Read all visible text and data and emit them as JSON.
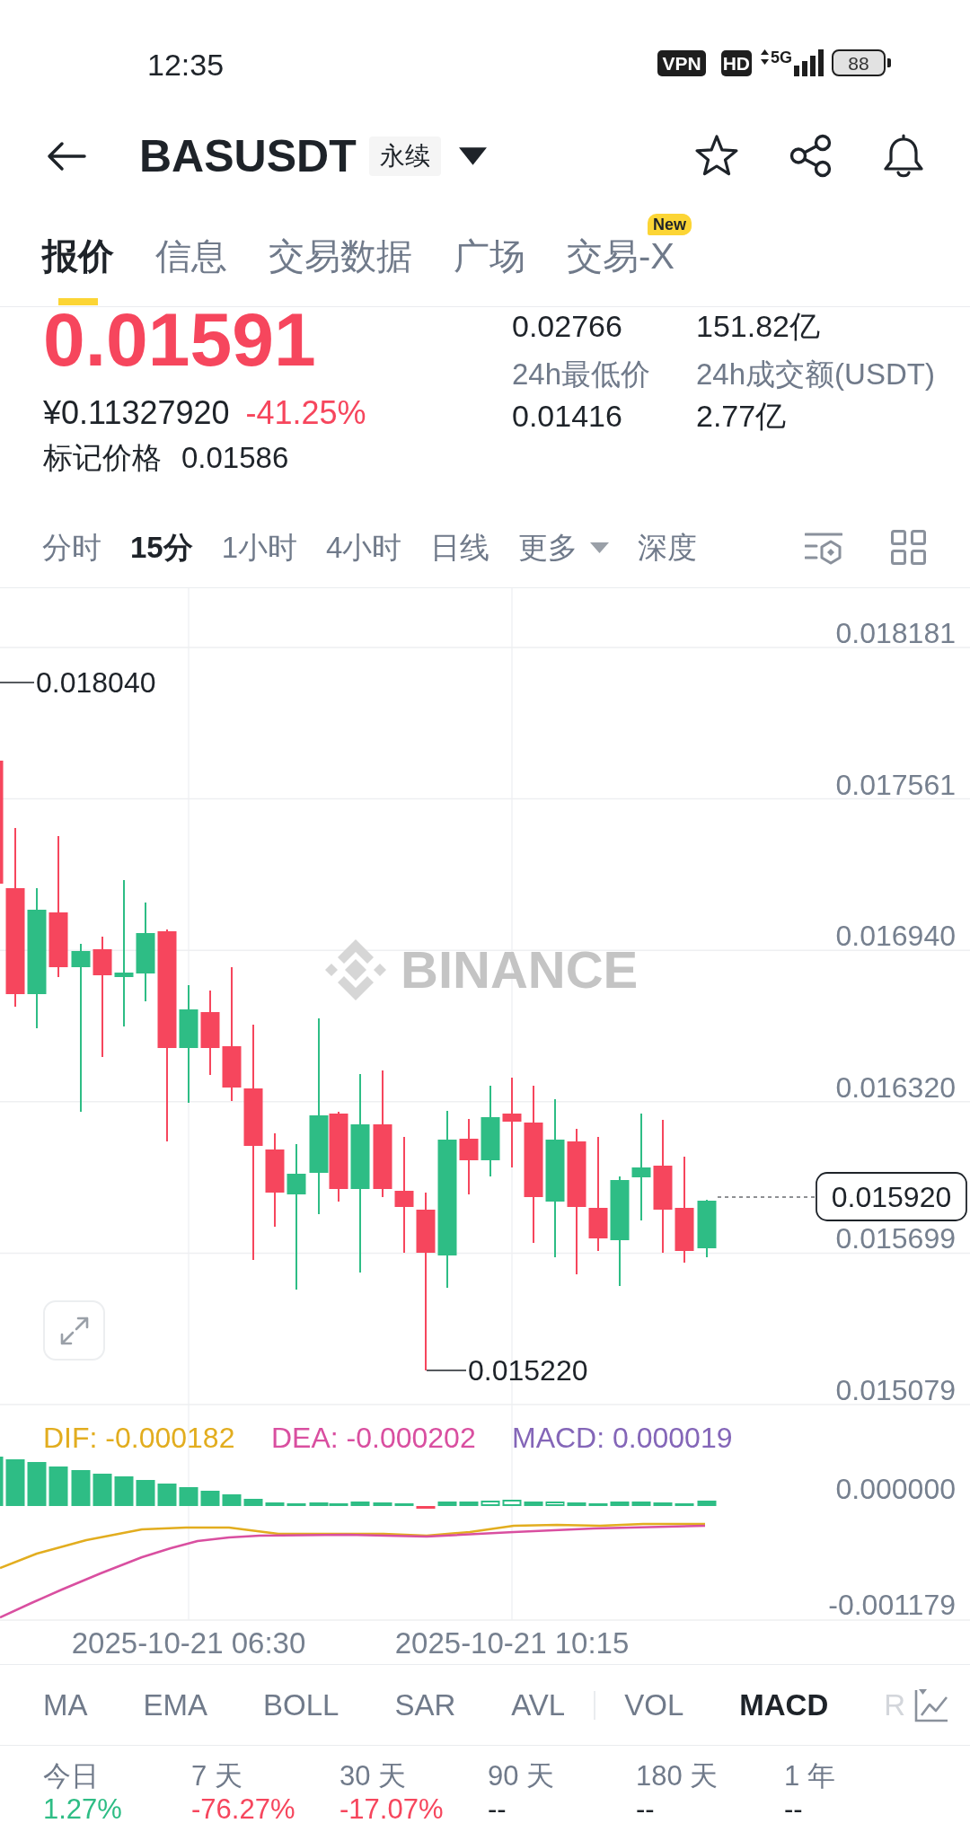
{
  "status_bar": {
    "time": "12:35",
    "vpn": "VPN",
    "hd": "HD",
    "network": "5G",
    "battery": "88"
  },
  "header": {
    "symbol": "BASUSDT",
    "contract_type": "永续"
  },
  "tabs": [
    {
      "label": "报价",
      "selected": true
    },
    {
      "label": "信息",
      "selected": false
    },
    {
      "label": "交易数据",
      "selected": false
    },
    {
      "label": "广场",
      "selected": false
    },
    {
      "label": "交易-X",
      "selected": false,
      "badge": "New"
    }
  ],
  "price": {
    "last": "0.01591",
    "cny": "¥0.11327920",
    "change": "-41.25%",
    "mark_label": "标记价格",
    "mark_price": "0.01586"
  },
  "stats": [
    {
      "value": "0.02766"
    },
    {
      "value": "151.82亿"
    },
    {
      "label": "24h最低价",
      "value": "0.01416"
    },
    {
      "label": "24h成交额(USDT)",
      "value": "2.77亿"
    }
  ],
  "intervals": [
    {
      "label": "分时",
      "kind": "option",
      "selected": false
    },
    {
      "label": "15分",
      "kind": "option",
      "selected": true
    },
    {
      "label": "1小时",
      "kind": "option",
      "selected": false
    },
    {
      "label": "4小时",
      "kind": "option",
      "selected": false
    },
    {
      "label": "日线",
      "kind": "option",
      "selected": false
    },
    {
      "label": "更多",
      "kind": "dropdown",
      "selected": false
    },
    {
      "label": "深度",
      "kind": "option",
      "selected": false
    }
  ],
  "chart": {
    "watermark": "BINANCE",
    "price_axis": [
      "0.018181",
      "0.017561",
      "0.016940",
      "0.016320",
      "0.015699",
      "0.015079"
    ],
    "high_label": "0.018040",
    "low_label": "0.015220",
    "last_price": "0.015920"
  },
  "macd": {
    "dif": "DIF: -0.000182",
    "dea": "DEA: -0.000202",
    "macd": "MACD: 0.000019",
    "axis": [
      "0.000000",
      "-0.001179"
    ]
  },
  "time_axis": [
    "2025-10-21 06:30",
    "2025-10-21 10:15"
  ],
  "main_indicators": [
    {
      "label": "MA",
      "selected": false
    },
    {
      "label": "EMA",
      "selected": false
    },
    {
      "label": "BOLL",
      "selected": false
    },
    {
      "label": "SAR",
      "selected": false
    },
    {
      "label": "AVL",
      "selected": false
    }
  ],
  "sub_indicators": [
    {
      "label": "VOL",
      "selected": false
    },
    {
      "label": "MACD",
      "selected": true
    },
    {
      "label": "R",
      "selected": false
    }
  ],
  "periods": [
    {
      "label": "今日",
      "change": "1.27%",
      "color": "#2ebd85"
    },
    {
      "label": "7 天",
      "change": "-76.27%",
      "color": "#f6465d"
    },
    {
      "label": "30 天",
      "change": "-17.07%",
      "color": "#f6465d"
    },
    {
      "label": "90 天",
      "change": "--",
      "color": "#1e2329"
    },
    {
      "label": "180 天",
      "change": "--",
      "color": "#1e2329"
    },
    {
      "label": "1 年",
      "change": "--",
      "color": "#1e2329"
    }
  ]
}
